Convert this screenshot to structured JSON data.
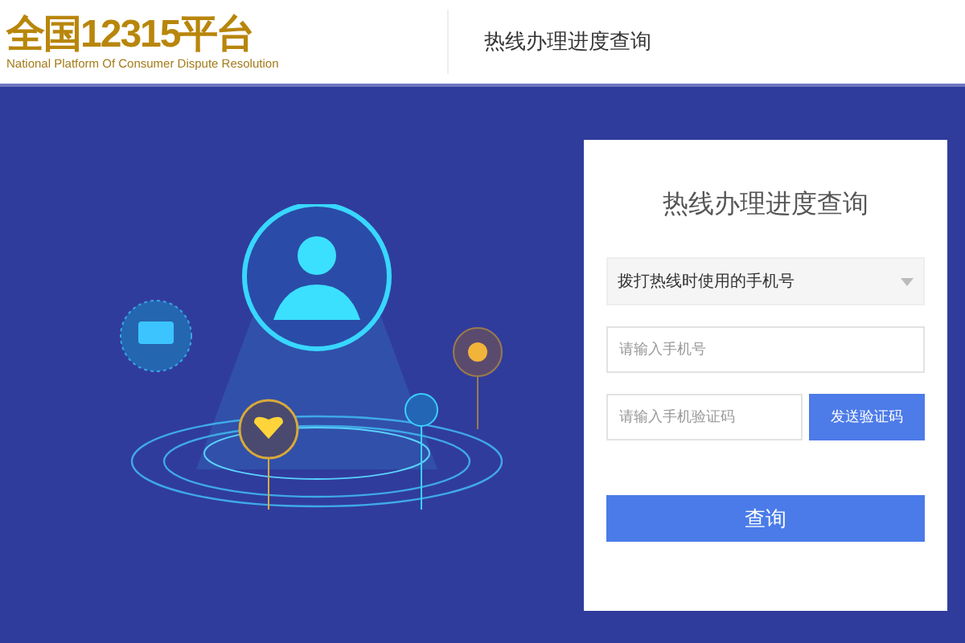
{
  "header": {
    "logo_title": "全国12315平台",
    "logo_subtitle": "National Platform Of Consumer Dispute Resolution",
    "page_title": "热线办理进度查询"
  },
  "form": {
    "title": "热线办理进度查询",
    "select": {
      "value": "拨打热线时使用的手机号"
    },
    "phone": {
      "placeholder": "请输入手机号"
    },
    "code": {
      "placeholder": "请输入手机验证码"
    },
    "send_button": "发送验证码",
    "submit_button": "查询"
  }
}
